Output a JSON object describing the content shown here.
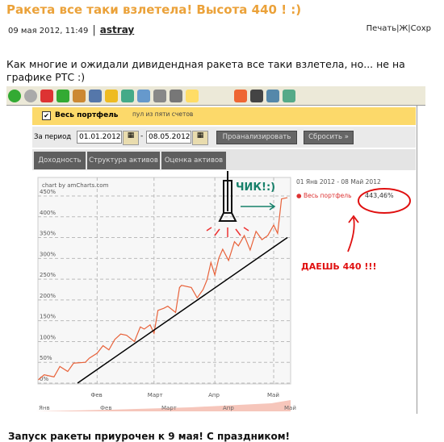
{
  "post": {
    "title": "Ракета все таки взлетела! Высота 440 ! :)",
    "date": "09 мая 2012, 11:49",
    "author": "astray",
    "actions": [
      "Печать",
      "Ж",
      "Сохр"
    ],
    "body": "Как  многие и ожидали дивидендная ракета все таки взлетела, но... не на графике РТС :)",
    "footer": "Запуск ракеты приурочен к 9 мая! С праздником!"
  },
  "screenshot": {
    "toolbar_icons": [
      "back-icon",
      "forward-icon",
      "stop-icon",
      "refresh-icon",
      "home-icon",
      "search-icon",
      "favorites-icon",
      "history-icon",
      "mail-icon",
      "print-icon",
      "edit-icon",
      "note-icon",
      "at-icon",
      "app-icon",
      "tool-icon",
      "messenger-icon"
    ],
    "portfolio_checkbox": {
      "label": "Весь портфель",
      "checked": true
    },
    "portfolio_note": "пул из пяти счетов",
    "period_label": "За период",
    "date_from": "01.01.2012",
    "date_to": "08.05.2012",
    "analyze_button": "Проанализировать",
    "reset_button": "Сбросить »",
    "tabs": [
      "Доходность",
      "Структура активов",
      "Оценка активов"
    ],
    "credit": "chart by amCharts.com",
    "legend_range": "01 Янв 2012 - 08 Май 2012",
    "legend_series": "Весь портфель",
    "legend_value": "443,46%",
    "annotation_chik": "ЧИК!:)",
    "annotation_daesh": "ДАЕШЬ 440 !!!"
  },
  "chart_data": {
    "type": "line",
    "ylim": [
      0,
      450
    ],
    "yticks": [
      "0%",
      "50%",
      "100%",
      "150%",
      "200%",
      "250%",
      "300%",
      "350%",
      "400%",
      "450%"
    ],
    "xticks": [
      "Фев",
      "Март",
      "Апр",
      "Май"
    ],
    "navigator_labels": [
      "Янв",
      "Фев",
      "Март",
      "Апр",
      "Май"
    ],
    "series": [
      {
        "name": "Весь портфель",
        "color": "#e8623a",
        "x": [
          "2012-01-02",
          "2012-01-05",
          "2012-01-10",
          "2012-01-13",
          "2012-01-17",
          "2012-01-20",
          "2012-01-26",
          "2012-01-28",
          "2012-02-01",
          "2012-02-04",
          "2012-02-07",
          "2012-02-10",
          "2012-02-13",
          "2012-02-16",
          "2012-02-20",
          "2012-02-23",
          "2012-02-25",
          "2012-02-28",
          "2012-03-01",
          "2012-03-03",
          "2012-03-06",
          "2012-03-08",
          "2012-03-12",
          "2012-03-14",
          "2012-03-15",
          "2012-03-20",
          "2012-03-23",
          "2012-03-26",
          "2012-03-28",
          "2012-03-30",
          "2012-04-01",
          "2012-04-03",
          "2012-04-05",
          "2012-04-08",
          "2012-04-11",
          "2012-04-13",
          "2012-04-16",
          "2012-04-19",
          "2012-04-22",
          "2012-04-25",
          "2012-04-28",
          "2012-05-01",
          "2012-05-03",
          "2012-05-05",
          "2012-05-08"
        ],
        "values": [
          8,
          20,
          15,
          40,
          28,
          48,
          50,
          60,
          72,
          90,
          80,
          105,
          118,
          115,
          100,
          135,
          130,
          140,
          120,
          175,
          180,
          185,
          170,
          230,
          235,
          230,
          205,
          225,
          248,
          290,
          260,
          300,
          322,
          295,
          340,
          330,
          355,
          320,
          365,
          345,
          355,
          380,
          360,
          443,
          446
        ]
      }
    ],
    "trend_line": {
      "color": "#000000",
      "x": [
        "2012-01-22",
        "2012-05-08"
      ],
      "values": [
        0,
        350
      ]
    }
  }
}
